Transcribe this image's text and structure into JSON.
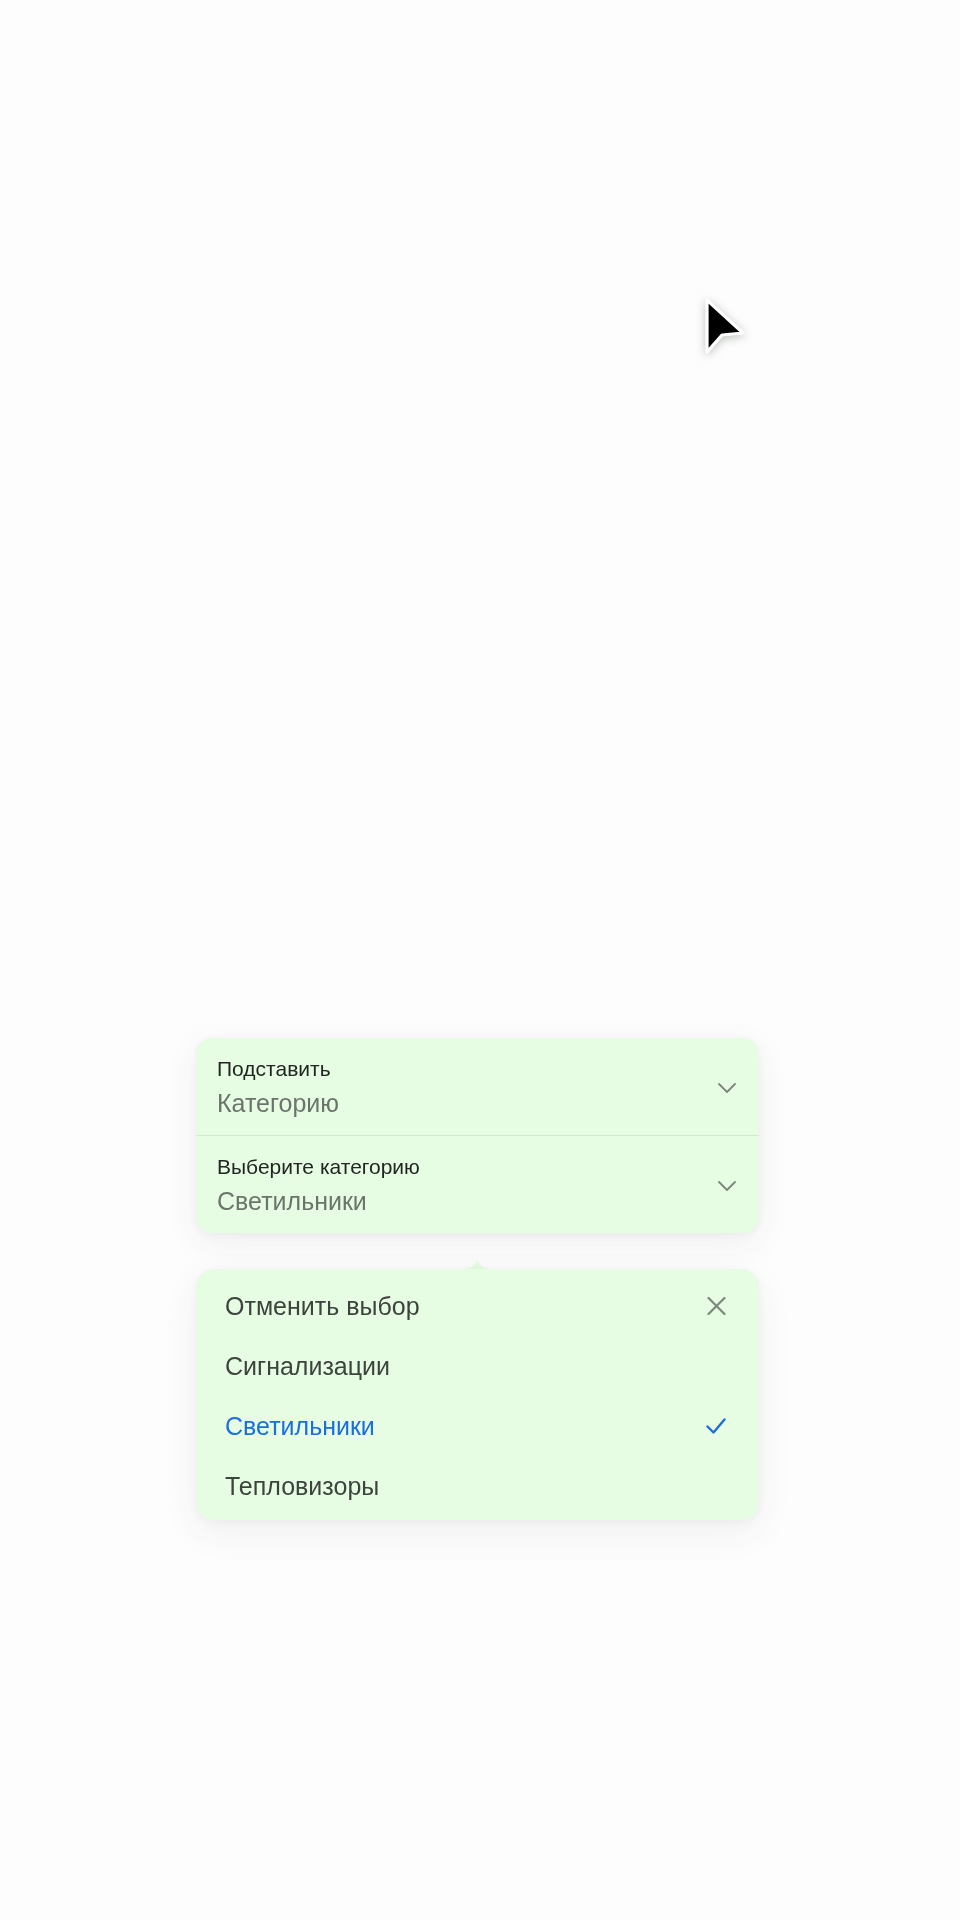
{
  "form": {
    "fields": [
      {
        "label": "Подставить",
        "value": "Категорию"
      },
      {
        "label": "Выберите категорию",
        "value": "Светильники"
      }
    ]
  },
  "dropdown": {
    "items": [
      {
        "kind": "clear",
        "label": "Отменить выбор",
        "selected": false
      },
      {
        "kind": "option",
        "label": "Сигнализации",
        "selected": false
      },
      {
        "kind": "option",
        "label": "Светильники",
        "selected": true
      },
      {
        "kind": "option",
        "label": "Тепловизоры",
        "selected": false
      }
    ]
  }
}
